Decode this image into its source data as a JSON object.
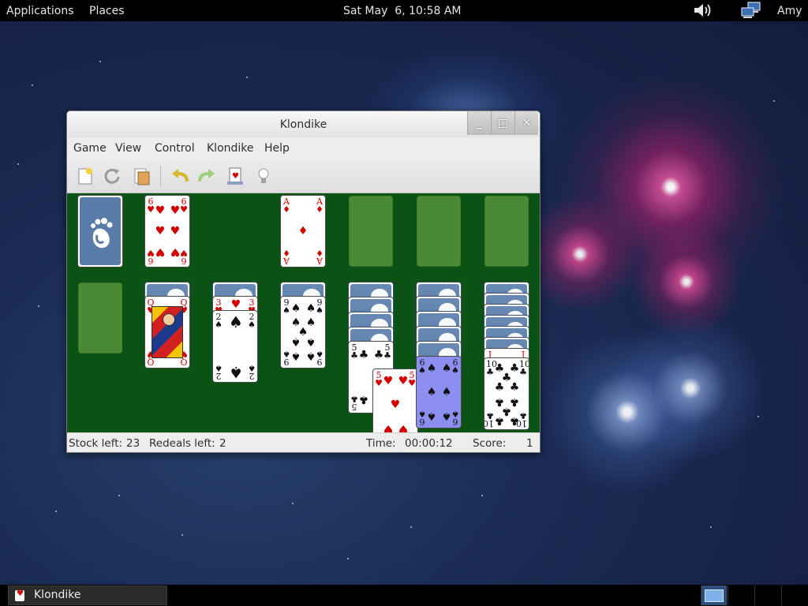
{
  "top_panel": {
    "applications": "Applications",
    "places": "Places",
    "clock": "Sat May  6, 10:58 AM",
    "user": "Amy",
    "icons": [
      "volume-icon",
      "network-icon"
    ]
  },
  "window": {
    "title": "Klondike",
    "controls": [
      "minimize",
      "maximize",
      "close"
    ],
    "menu": [
      "Game",
      "View",
      "Control",
      "Klondike",
      "Help"
    ],
    "toolbar": [
      "new-game-icon",
      "restart-icon",
      "select-game-icon",
      "undo-icon",
      "redo-icon",
      "deal-icon",
      "hint-icon"
    ],
    "status": {
      "stock_label": "Stock left:",
      "stock_value": "23",
      "redeals_label": "Redeals left:",
      "redeals_value": "2",
      "time_label": "Time:",
      "time_value": "00:00:12",
      "score_label": "Score:",
      "score_value": "1"
    }
  },
  "cards": {
    "waste": {
      "rank": "6",
      "suit": "♥"
    },
    "foundation_1": {
      "rank": "A",
      "suit": "♦"
    },
    "tableau_2": {
      "rank": "Q",
      "suit": "♥"
    },
    "tableau_3a": {
      "rank": "3",
      "suit": "♥"
    },
    "tableau_3b": {
      "rank": "2",
      "suit": "♠"
    },
    "tableau_4": {
      "rank": "9",
      "suit": "♠"
    },
    "tableau_5a": {
      "rank": "5",
      "suit": "♣"
    },
    "tableau_5b": {
      "rank": "5",
      "suit": "♥"
    },
    "tableau_6": {
      "rank": "6",
      "suit": "♠"
    },
    "tableau_7a": {
      "rank": "J",
      "suit": "♥"
    },
    "tableau_7b": {
      "rank": "10",
      "suit": "♣"
    }
  },
  "taskbar": {
    "task_label": "Klondike",
    "workspaces": 4
  },
  "colors": {
    "felt": "#0b5314",
    "empty_slot": "#4a8a35",
    "card_back": "#5a7ca8",
    "selected_card": "#8c8ff0",
    "red_suit": "#d40000",
    "panel": "#000000"
  }
}
